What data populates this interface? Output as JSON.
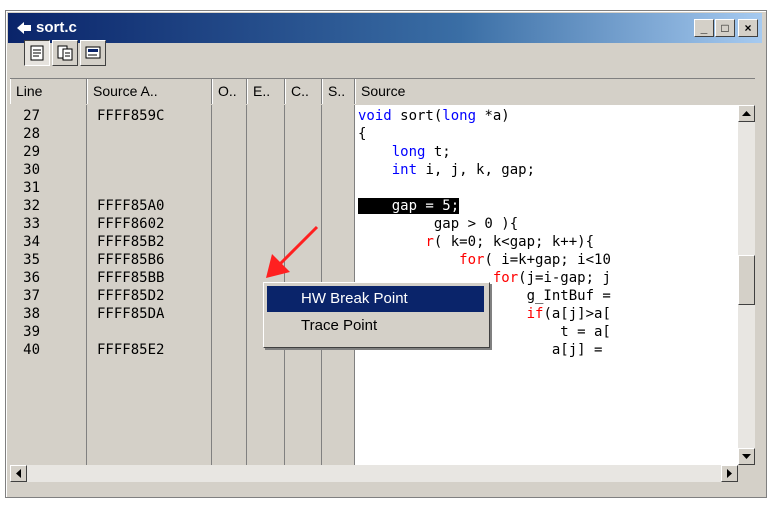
{
  "window": {
    "title": "sort.c"
  },
  "title_buttons": {
    "minimize": "_",
    "maximize": "□",
    "close": "×"
  },
  "toolbar": {
    "buttons": [
      "source-view-icon",
      "mixed-view-icon",
      "disassembly-view-icon"
    ]
  },
  "columns": [
    "Line",
    "Source A..",
    "O..",
    "E..",
    "C..",
    "S..",
    "Source"
  ],
  "rows": [
    {
      "line": "27",
      "addr": "FFFF859C"
    },
    {
      "line": "28",
      "addr": ""
    },
    {
      "line": "29",
      "addr": ""
    },
    {
      "line": "30",
      "addr": ""
    },
    {
      "line": "31",
      "addr": ""
    },
    {
      "line": "32",
      "addr": "FFFF85A0"
    },
    {
      "line": "33",
      "addr": "FFFF8602"
    },
    {
      "line": "34",
      "addr": "FFFF85B2"
    },
    {
      "line": "35",
      "addr": "FFFF85B6"
    },
    {
      "line": "36",
      "addr": "FFFF85BB"
    },
    {
      "line": "37",
      "addr": "FFFF85D2"
    },
    {
      "line": "38",
      "addr": "FFFF85DA"
    },
    {
      "line": "39",
      "addr": ""
    },
    {
      "line": "40",
      "addr": "FFFF85E2"
    }
  ],
  "source": {
    "l27a": "void",
    "l27b": " sort(",
    "l27c": "long",
    "l27d": " *a)",
    "l28": "{",
    "l29a": "    ",
    "l29b": "long",
    "l29c": " t;",
    "l30a": "    ",
    "l30b": "int",
    "l30c": " i, j, k, gap;",
    "l32": "    gap = 5;",
    "l33": "         gap > 0 ){",
    "l34a": "        ",
    "l34b": "r",
    "l34c": "( k=0; k<gap; k++){",
    "l35a": "            ",
    "l35b": "for",
    "l35c": "( i=k+gap; i<10",
    "l36a": "                ",
    "l36b": "for",
    "l36c": "(j=i-gap; j",
    "l37": "                    g_IntBuf =",
    "l38a": "                    ",
    "l38b": "if",
    "l38c": "(a[j]>a[",
    "l39": "                        t = a[",
    "l40": "                       a[j] ="
  },
  "context_menu": {
    "items": [
      "HW Break Point",
      "Trace Point"
    ]
  }
}
